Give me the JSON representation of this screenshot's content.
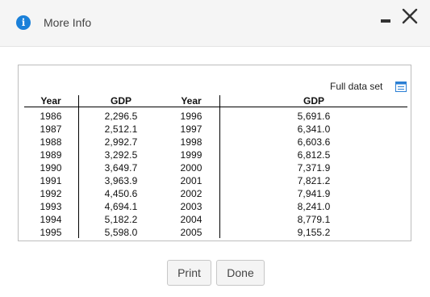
{
  "dialog": {
    "title": "More Info"
  },
  "table": {
    "full_data_label": "Full data set",
    "headers": {
      "year1": "Year",
      "gdp1": "GDP",
      "year2": "Year",
      "gdp2": "GDP"
    },
    "left": {
      "years": [
        "1986",
        "1987",
        "1988",
        "1989",
        "1990",
        "1991",
        "1992",
        "1993",
        "1994",
        "1995"
      ],
      "gdp": [
        "2,296.5",
        "2,512.1",
        "2,992.7",
        "3,292.5",
        "3,649.7",
        "3,963.9",
        "4,450.6",
        "4,694.1",
        "5,182.2",
        "5,598.0"
      ]
    },
    "right": {
      "years": [
        "1996",
        "1997",
        "1998",
        "1999",
        "2000",
        "2001",
        "2002",
        "2003",
        "2004",
        "2005"
      ],
      "gdp": [
        "5,691.6",
        "6,341.0",
        "6,603.6",
        "6,812.5",
        "7,371.9",
        "7,821.2",
        "7,941.9",
        "8,241.0",
        "8,779.1",
        "9,155.2"
      ]
    }
  },
  "buttons": {
    "print": "Print",
    "done": "Done"
  },
  "colors": {
    "info_icon": "#1a80d9",
    "full_data_icon": "#2a7fd4",
    "titlebar_bg": "#f5f5f5"
  }
}
